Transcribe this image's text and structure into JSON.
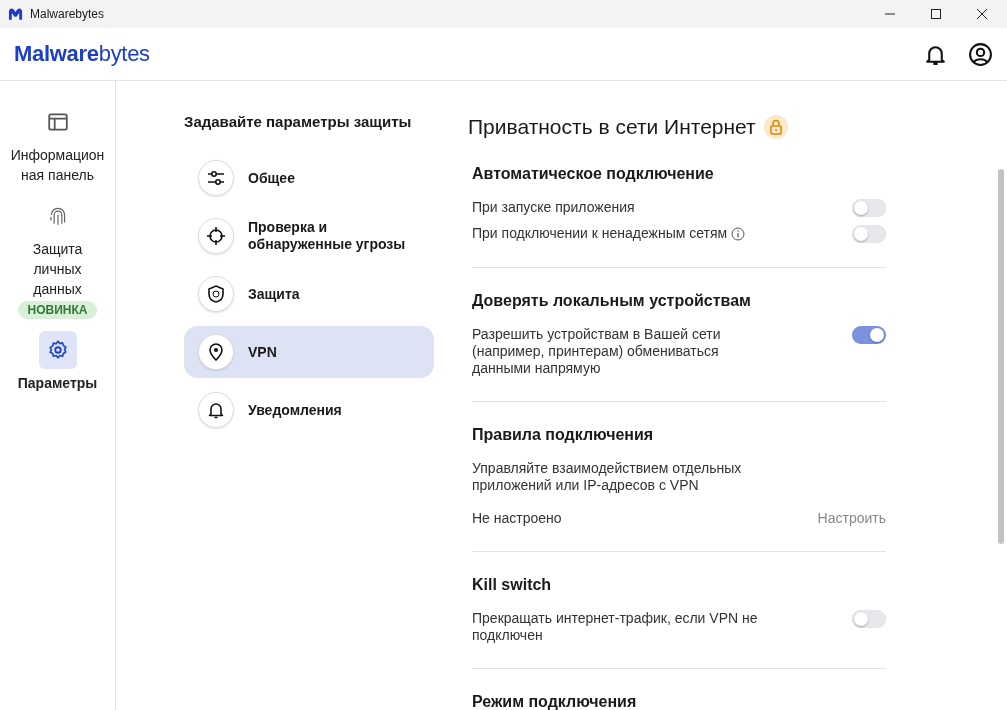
{
  "window": {
    "title": "Malwarebytes"
  },
  "header": {
    "logo": "**Malware**bytes"
  },
  "nav": [
    {
      "label": "Информационная панель",
      "selected": false
    },
    {
      "label": "Защита личных данных",
      "selected": false,
      "badge": "НОВИНКА"
    },
    {
      "label": "Параметры",
      "selected": true
    }
  ],
  "settings_menu": {
    "title": "Задавайте параметры защиты",
    "items": [
      {
        "label": "Общее",
        "selected": false
      },
      {
        "label": "Проверка и обнаруженные угрозы",
        "selected": false
      },
      {
        "label": "Защита",
        "selected": false
      },
      {
        "label": "VPN",
        "selected": true
      },
      {
        "label": "Уведомления",
        "selected": false
      }
    ]
  },
  "page": {
    "title": "Приватность в сети Интернет",
    "sections": [
      {
        "title": "Автоматическое подключение",
        "rows": [
          {
            "kind": "toggle",
            "label": "При запуске приложения",
            "on": false
          },
          {
            "kind": "toggle-info",
            "label": "При подключении к ненадежным сетям",
            "on": false
          }
        ]
      },
      {
        "title": "Доверять локальным устройствам",
        "rows": [
          {
            "kind": "toggle",
            "label": "Разрешить устройствам в Вашей сети (например, принтерам) обмениваться данными напрямую",
            "on": true
          }
        ]
      },
      {
        "title": "Правила подключения",
        "rows": [
          {
            "kind": "text",
            "label": "Управляйте взаимодействием отдельных приложений или IP-адресов с VPN"
          },
          {
            "kind": "link",
            "label": "Не настроено",
            "action": "Настроить"
          }
        ]
      },
      {
        "title": "Kill switch",
        "rows": [
          {
            "kind": "toggle",
            "label": "Прекращать интернет-трафик, если VPN не подключен",
            "on": false
          }
        ]
      },
      {
        "title": "Режим подключения"
      }
    ]
  }
}
